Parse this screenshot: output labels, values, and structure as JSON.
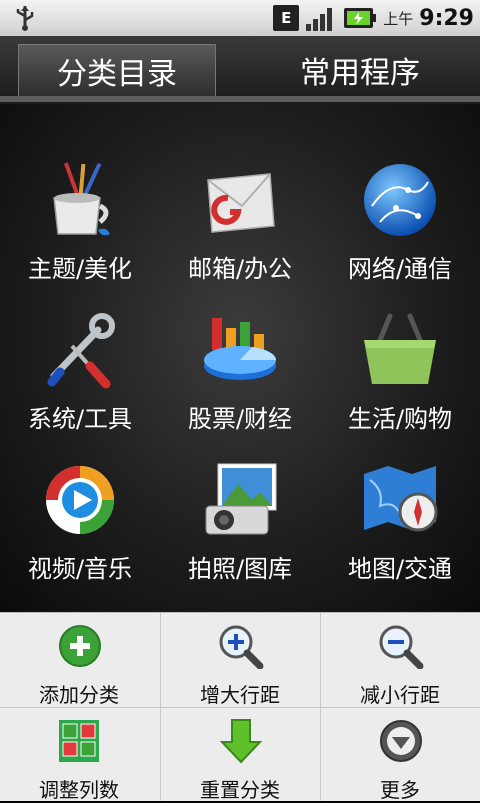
{
  "status_bar": {
    "time_prefix": "上午",
    "time": "9:29",
    "network_badge": "E"
  },
  "tabs": [
    {
      "label": "分类目录",
      "active": true
    },
    {
      "label": "常用程序",
      "active": false
    }
  ],
  "categories": [
    {
      "label": "主题/美化",
      "icon": "paintbrush-cup-icon"
    },
    {
      "label": "邮箱/办公",
      "icon": "mail-envelope-icon"
    },
    {
      "label": "网络/通信",
      "icon": "globe-network-icon"
    },
    {
      "label": "系统/工具",
      "icon": "tools-wrench-icon"
    },
    {
      "label": "股票/财经",
      "icon": "chart-finance-icon"
    },
    {
      "label": "生活/购物",
      "icon": "shopping-basket-icon"
    },
    {
      "label": "视频/音乐",
      "icon": "media-play-icon"
    },
    {
      "label": "拍照/图库",
      "icon": "camera-photo-icon"
    },
    {
      "label": "地图/交通",
      "icon": "map-compass-icon"
    }
  ],
  "menu": [
    {
      "label": "添加分类",
      "icon": "add-icon"
    },
    {
      "label": "增大行距",
      "icon": "zoom-in-icon"
    },
    {
      "label": "减小行距",
      "icon": "zoom-out-icon"
    },
    {
      "label": "调整列数",
      "icon": "columns-icon"
    },
    {
      "label": "重置分类",
      "icon": "reset-arrow-icon"
    },
    {
      "label": "更多",
      "icon": "more-icon"
    }
  ],
  "colors": {
    "accent_green": "#3aa236",
    "tab_bg": "#2c2c2c",
    "menu_bg": "#ececec"
  }
}
